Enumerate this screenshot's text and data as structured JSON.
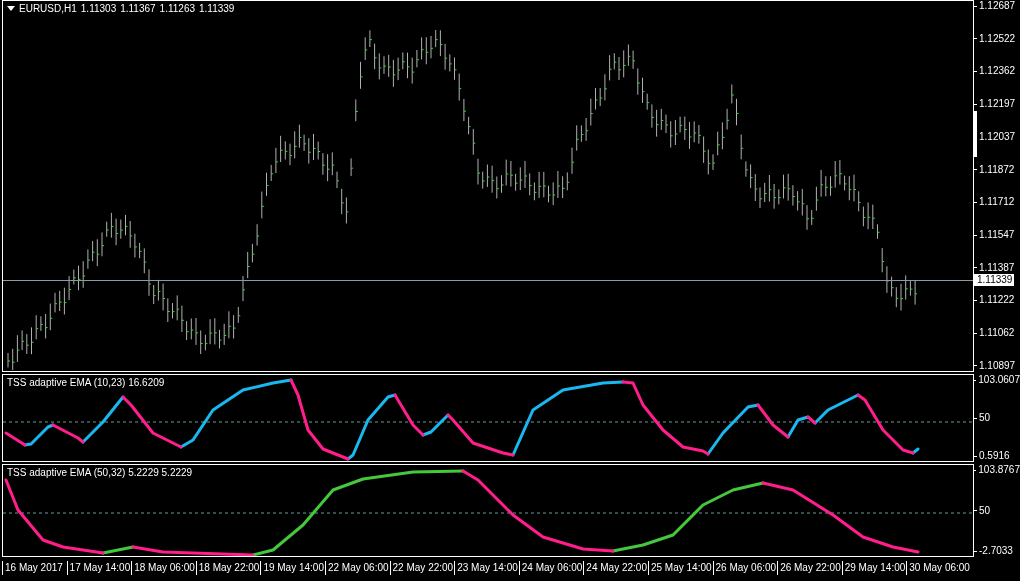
{
  "header": {
    "symbol": "EURUSD,H1",
    "ohlc": [
      "1.11303",
      "1.11367",
      "1.11263",
      "1.11339"
    ]
  },
  "price_axis": [
    "1.12687",
    "1.12522",
    "1.12362",
    "1.12197",
    "1.12037",
    "1.11872",
    "1.11712",
    "1.11547",
    "1.11387",
    "1.11222",
    "1.11062",
    "1.10897"
  ],
  "current_price": "1.11339",
  "indicators": [
    {
      "label": "TSS adaptive EMA (10,23) 16.6209",
      "axis": [
        "103.0607",
        "50",
        "0.5916"
      ]
    },
    {
      "label": "TSS adaptive EMA (50,32) 5.2229 5.2229",
      "axis": [
        "103.8767",
        "50",
        "-2.7033"
      ]
    }
  ],
  "time_axis": [
    "16 May 2017",
    "17 May 14:00",
    "18 May 06:00",
    "18 May 22:00",
    "19 May 14:00",
    "22 May 06:00",
    "22 May 22:00",
    "23 May 14:00",
    "24 May 06:00",
    "24 May 22:00",
    "25 May 14:00",
    "26 May 06:00",
    "26 May 22:00",
    "29 May 14:00",
    "30 May 06:00"
  ]
}
